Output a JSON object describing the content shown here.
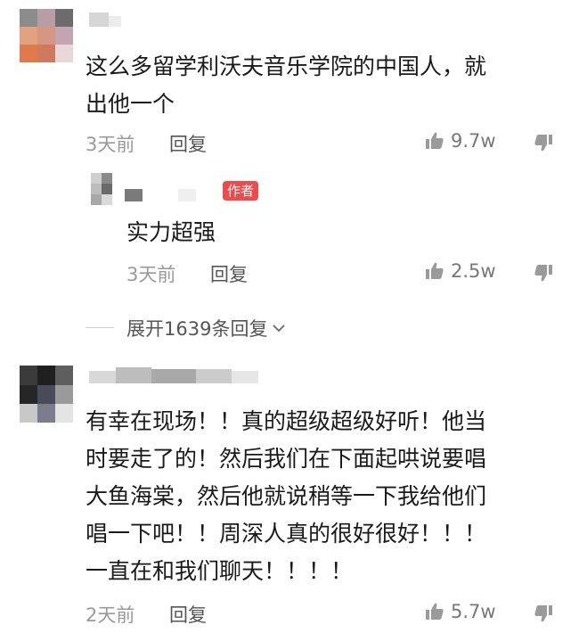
{
  "comments": [
    {
      "text_line1": "这么多留学利沃夫音乐学院的中国人，就",
      "text_line2": "出他一个",
      "time": "3天前",
      "reply_label": "回复",
      "likes": "9.7w"
    },
    {
      "badge": "作者",
      "text": "实力超强",
      "time": "3天前",
      "reply_label": "回复",
      "likes": "2.5w"
    },
    {
      "text_lines": [
        "有幸在现场！！真的超级超级好听！他当",
        "时要走了的！然后我们在下面起哄说要唱",
        "大鱼海棠，然后他就说稍等一下我给他们",
        "唱一下吧！！周深人真的很好很好！！！",
        "一直在和我们聊天！！！！"
      ],
      "time": "2天前",
      "reply_label": "回复",
      "likes": "5.7w"
    }
  ],
  "expand_label": "展开1639条回复",
  "icons": {
    "like": "thumbs-up-icon",
    "dislike": "thumbs-down-icon",
    "expand": "chevron-down-icon"
  }
}
